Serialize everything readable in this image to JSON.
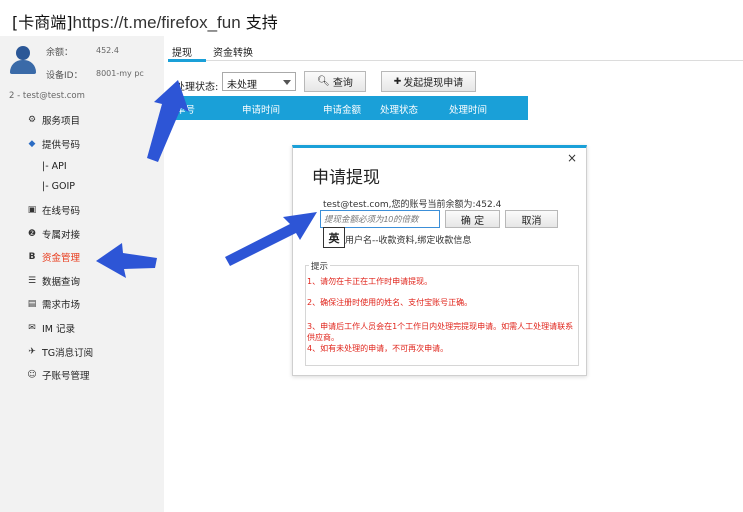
{
  "header": {
    "title_bracket": "[卡商端]",
    "title_link": "https://t.me/firefox_fun",
    "title_suffix": " 支持"
  },
  "user": {
    "balance_label": "余额：",
    "balance_value": "452.4",
    "device_label": "设备ID：",
    "device_value": "8001-my pc",
    "account": "2 - test@test.com"
  },
  "sidebar": {
    "items": [
      {
        "label": "服务项目",
        "icon": "service-icon"
      },
      {
        "label": "提供号码",
        "icon": "diamond-icon"
      },
      {
        "label": "|- API"
      },
      {
        "label": "|- GOIP"
      },
      {
        "label": "在线号码",
        "icon": "monitor-icon"
      },
      {
        "label": "专属对接",
        "icon": "link-icon"
      },
      {
        "label": "资金管理",
        "icon": "bitcoin-icon"
      },
      {
        "label": "数据查询",
        "icon": "list-icon"
      },
      {
        "label": "需求市场",
        "icon": "document-icon"
      },
      {
        "label": "IM 记录",
        "icon": "mail-icon"
      },
      {
        "label": "TG消息订阅",
        "icon": "telegram-icon"
      },
      {
        "label": "子账号管理",
        "icon": "users-icon"
      }
    ],
    "active": "资金管理",
    "accent": "#e8391a"
  },
  "tabs": [
    {
      "label": "提现",
      "active": true
    },
    {
      "label": "资金转换",
      "active": false
    }
  ],
  "filter": {
    "label": "处理状态:",
    "selected": "未处理",
    "query_button": "查询",
    "create_button": "发起提现申请"
  },
  "table": {
    "columns": [
      "单号",
      "申请时间",
      "申请金额",
      "处理状态",
      "处理时间"
    ],
    "header_color": "#1aa0d8"
  },
  "dialog": {
    "title": "申请提现",
    "close": "×",
    "balance_text": "test@test.com,您的账号当前余额为:452.4",
    "amount_placeholder": "提现金额必须为10的倍数",
    "ok_button": "确 定",
    "cancel_button": "取消",
    "ime_indicator": "英",
    "link_text": "用户名--收款资料,绑定收款信息",
    "tips_title": "提示",
    "tips": [
      "1、请勿在卡正在工作时申请提现。",
      "2、确保注册时使用的姓名、支付宝账号正确。",
      "3、申请后工作人员会在1个工作日内处理完提现申请。如需人工处理请联系供应商。",
      "4、如有未处理的申请，不可再次申请。"
    ],
    "tip_color": "#e0241b"
  },
  "annotation_color": "#2d55d6"
}
